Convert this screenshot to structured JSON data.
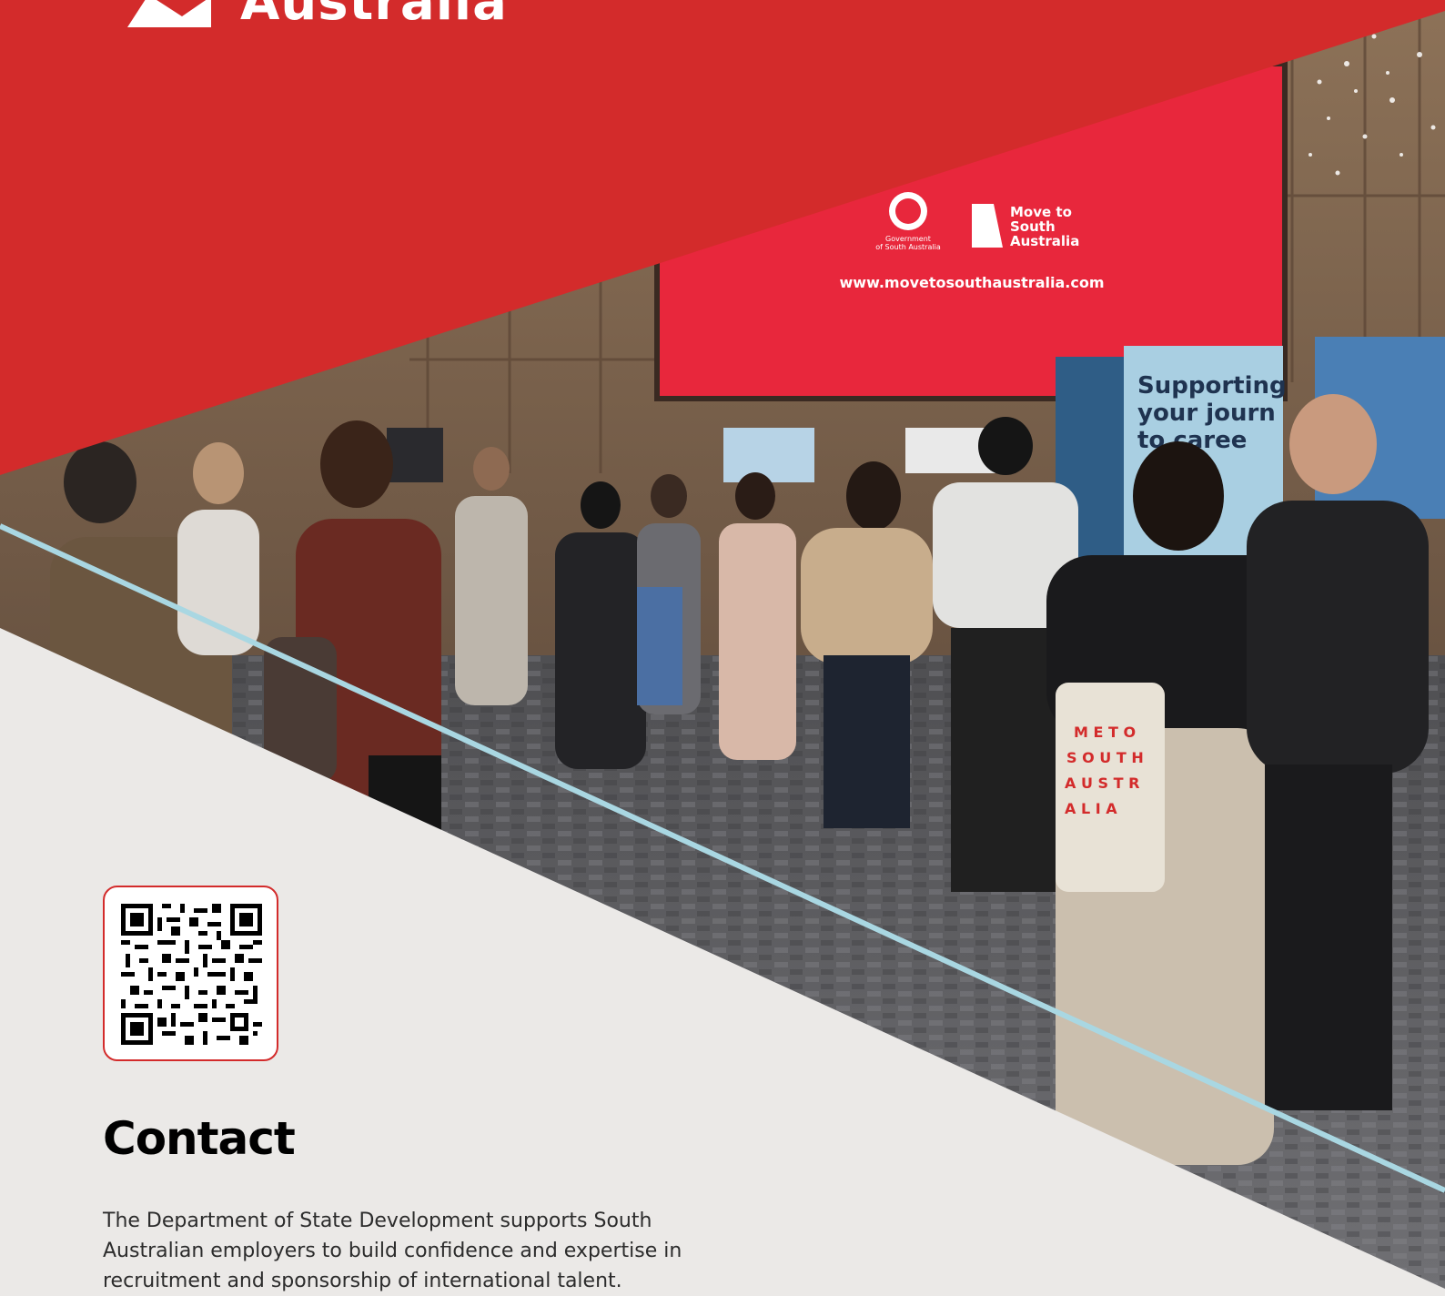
{
  "header": {
    "logo_text": "Australia",
    "colors": {
      "brand_red": "#d32b2b",
      "accent_blue": "#a9d7e2",
      "background": "#ebe9e7"
    }
  },
  "photo": {
    "screen": {
      "gov_label_line1": "Government",
      "gov_label_line2": "of South Australia",
      "brand_line1": "Move to",
      "brand_line2": "South",
      "brand_line3": "Australia",
      "url": "www.movetosouthaustralia.com"
    },
    "banner": {
      "line1": "Supporting",
      "line2": "your journ",
      "line3": "to caree"
    },
    "tote_bag": {
      "row1": "M E T O",
      "row2": "S O U T H",
      "row3": "A U S T R",
      "row4": "A L I A"
    }
  },
  "contact": {
    "title": "Contact",
    "body": "The Department of State Development supports South Australian employers to build confidence and expertise in recruitment and sponsorship of international talent."
  },
  "icons": {
    "qr_code": "qr-code-icon",
    "logo": "brand-logo-icon"
  }
}
